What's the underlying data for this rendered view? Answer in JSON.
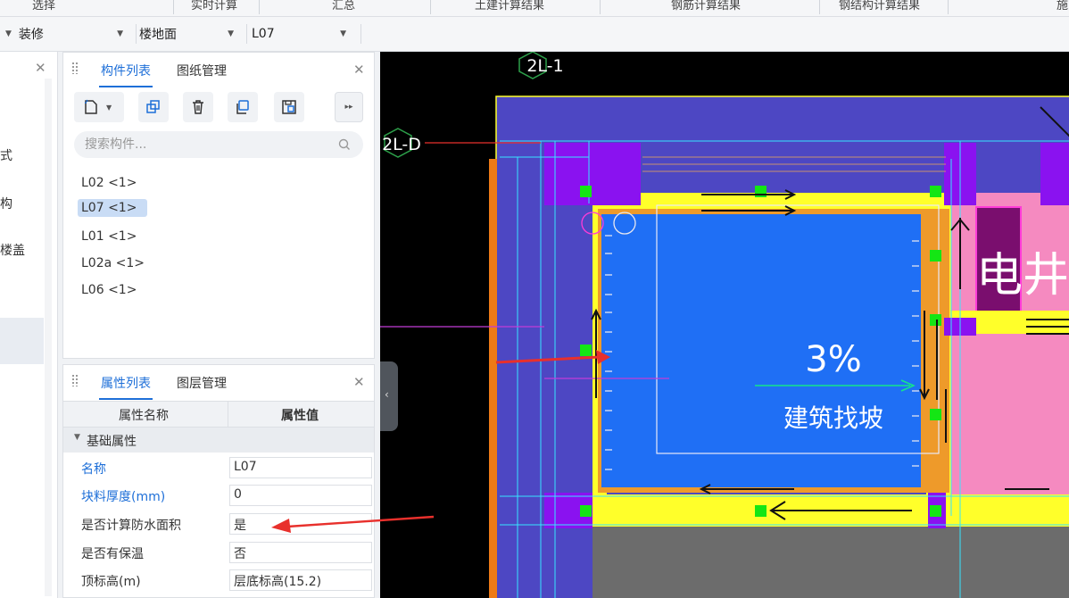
{
  "ribbon": {
    "groups": [
      "选择",
      "实时计算",
      "汇总",
      "土建计算结果",
      "钢筋计算结果",
      "钢结构计算结果",
      "施"
    ]
  },
  "filters": {
    "category": "装修",
    "type": "楼地面",
    "component": "L07"
  },
  "left_panel": {
    "items": [
      "式",
      "构",
      "楼盖"
    ]
  },
  "component_panel": {
    "tabs": [
      "构件列表",
      "图纸管理"
    ],
    "toolbar_icons": [
      "new-icon",
      "copy-icon",
      "delete-icon",
      "duplicate-icon",
      "save-icon",
      "more-icon"
    ],
    "search_placeholder": "搜索构件...",
    "items": [
      "L02 <1>",
      "L07 <1>",
      "L01 <1>",
      "L02a <1>",
      "L06 <1>"
    ],
    "selected_index": 1
  },
  "property_panel": {
    "tabs": [
      "属性列表",
      "图层管理"
    ],
    "col_name": "属性名称",
    "col_value": "属性值",
    "group": "基础属性",
    "rows": [
      {
        "name": "名称",
        "value": "L07"
      },
      {
        "name": "块料厚度(mm)",
        "value": "0"
      },
      {
        "name": "是否计算防水面积",
        "value": "是"
      },
      {
        "name": "是否有保温",
        "value": "否"
      },
      {
        "name": "顶标高(m)",
        "value": "层底标高(15.2)"
      }
    ]
  },
  "canvas": {
    "axis_labels": [
      "2L-1",
      "2L-D"
    ],
    "slope_text": "3%",
    "slope_label": "建筑找坡",
    "room_label": "电井"
  },
  "colors": {
    "accent": "#1e6fd8",
    "canvas_bg": "#000000",
    "floor_fill": "#1f6ff5",
    "wall_purple": "#4d47c3",
    "beam_yellow": "#ffff2a",
    "pink_room": "#f58ac0",
    "annotation_red": "#e8302c"
  }
}
